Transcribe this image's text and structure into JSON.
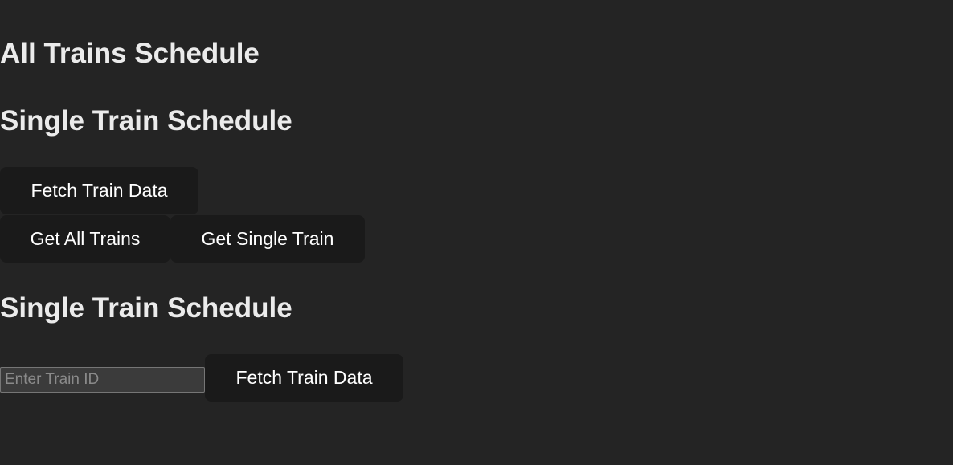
{
  "sections": {
    "all_trains_heading": "All Trains Schedule",
    "single_train_heading_1": "Single Train Schedule",
    "single_train_heading_2": "Single Train Schedule"
  },
  "buttons": {
    "fetch_train_data_top": "Fetch Train Data",
    "get_all_trains": "Get All Trains",
    "get_single_train": "Get Single Train",
    "fetch_train_data_bottom": "Fetch Train Data"
  },
  "train_id_input": {
    "placeholder": "Enter Train ID",
    "value": ""
  },
  "colors": {
    "background": "#242424",
    "button_background": "#1a1a1a",
    "heading_text": "#ebebeb",
    "button_text": "#ffffff"
  }
}
